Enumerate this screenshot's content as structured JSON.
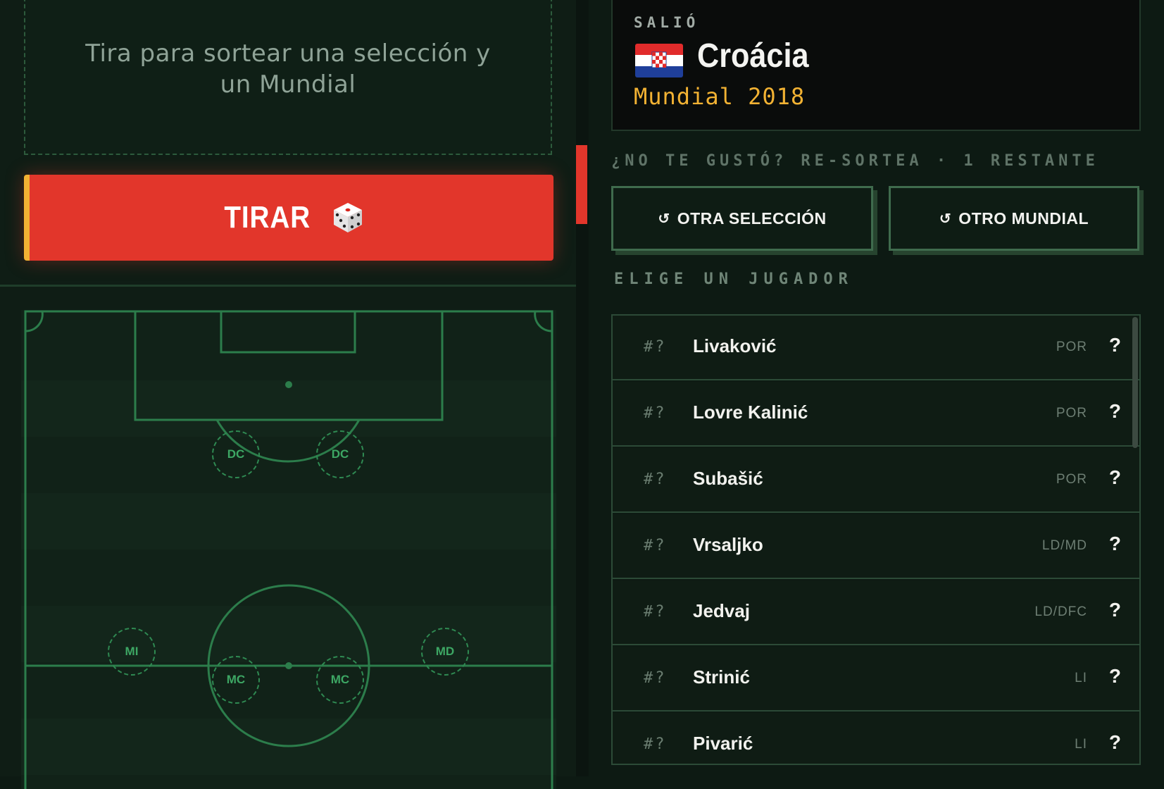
{
  "draw": {
    "prompt": "Tira para sortear una selección y un Mundial",
    "roll_label": "TIRAR"
  },
  "pitch": {
    "positions": [
      {
        "label": "DC"
      },
      {
        "label": "DC"
      },
      {
        "label": "MI"
      },
      {
        "label": "MC"
      },
      {
        "label": "MC"
      },
      {
        "label": "MD"
      }
    ]
  },
  "result": {
    "heading": "SALIÓ",
    "country": "Croácia",
    "world_cup": "Mundial 2018",
    "flag": "croatia-flag"
  },
  "reroll": {
    "note": "¿NO TE GUSTÓ? RE-SORTEA · 1 RESTANTE",
    "other_team": "OTRA SELECCIÓN",
    "other_cup": "OTRO MUNDIAL",
    "icon": "↺"
  },
  "players": {
    "heading": "ELIGE UN JUGADOR",
    "items": [
      {
        "number": "#?",
        "name": "Livaković",
        "position": "POR",
        "mark": "?"
      },
      {
        "number": "#?",
        "name": "Lovre Kalinić",
        "position": "POR",
        "mark": "?"
      },
      {
        "number": "#?",
        "name": "Subašić",
        "position": "POR",
        "mark": "?"
      },
      {
        "number": "#?",
        "name": "Vrsaljko",
        "position": "LD/MD",
        "mark": "?"
      },
      {
        "number": "#?",
        "name": "Jedvaj",
        "position": "LD/DFC",
        "mark": "?"
      },
      {
        "number": "#?",
        "name": "Strinić",
        "position": "LI",
        "mark": "?"
      },
      {
        "number": "#?",
        "name": "Pivarić",
        "position": "LI",
        "mark": "?"
      }
    ]
  },
  "colors": {
    "accent_red": "#e2362b",
    "accent_gold": "#f2b233",
    "pitch_line": "#2f8a52"
  }
}
